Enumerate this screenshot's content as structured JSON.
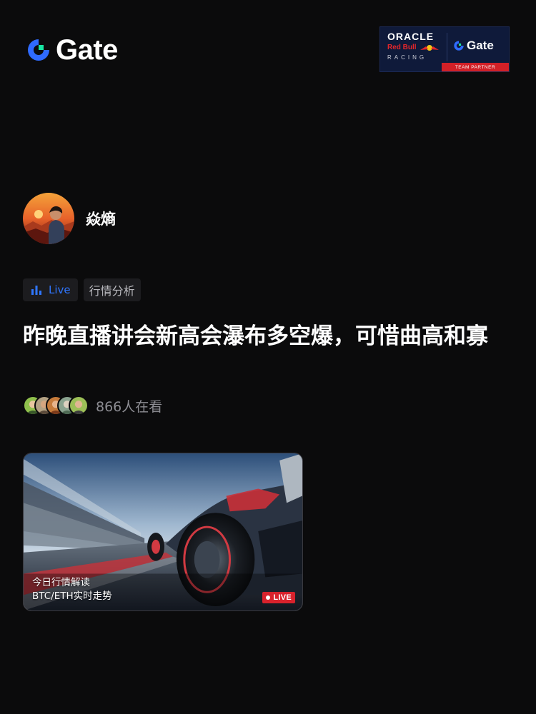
{
  "header": {
    "logo_text": "Gate",
    "logo_icon": "gate-logo-icon",
    "sponsor": {
      "oracle": "ORACLE",
      "redbull": "Red Bull",
      "racing": "RACING",
      "gate": "Gate",
      "team_partner": "TEAM PARTNER"
    }
  },
  "author": {
    "name": "焱熵",
    "avatar_icon": "avatar"
  },
  "tags": {
    "live_label": "Live",
    "live_icon": "bar-chart-icon",
    "category_label": "行情分析"
  },
  "post": {
    "title": "昨晚直播讲会新高会瀑布多空爆，可惜曲高和寡",
    "viewers_text": "866人在看"
  },
  "video": {
    "caption_line1": "今日行情解读",
    "caption_line2": "BTC/ETH实时走势",
    "live_badge": "LIVE"
  },
  "colors": {
    "background": "#0b0b0c",
    "accent_blue": "#2f76ff",
    "live_red": "#d8222c",
    "gate_green": "#17e6a1"
  }
}
